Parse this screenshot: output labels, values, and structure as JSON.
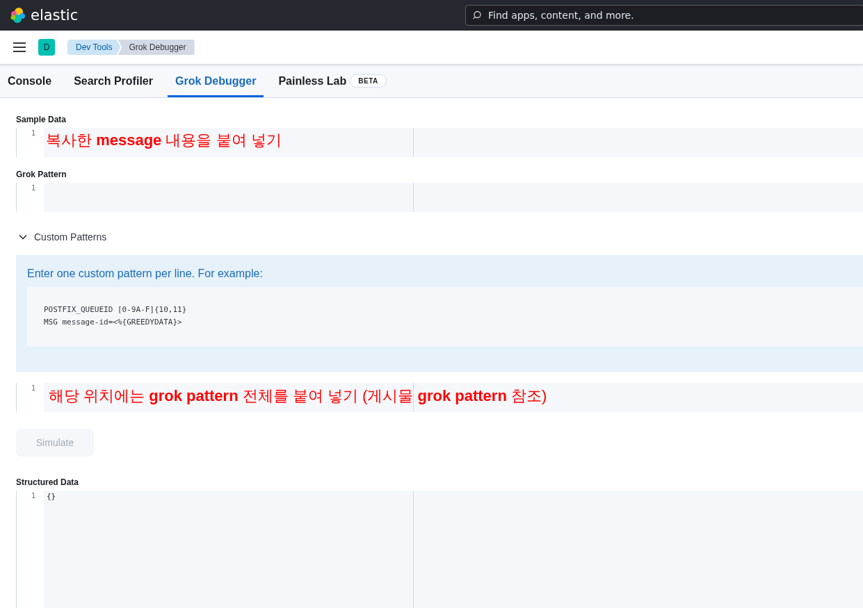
{
  "header": {
    "brand": "elastic",
    "search": {
      "placeholder": "Find apps, content, and more."
    }
  },
  "nav": {
    "space_initial": "D",
    "breadcrumbs": [
      {
        "label": "Dev Tools",
        "selected": false
      },
      {
        "label": "Grok Debugger",
        "selected": true
      }
    ]
  },
  "tabs": [
    {
      "label": "Console",
      "selected": false
    },
    {
      "label": "Search Profiler",
      "selected": false
    },
    {
      "label": "Grok Debugger",
      "selected": true
    },
    {
      "label": "Painless Lab",
      "selected": false,
      "badge": "BETA"
    }
  ],
  "sample_data": {
    "label": "Sample Data",
    "line_number": "1",
    "annotation": "복사한 **message** 내용을 붙여 넣기"
  },
  "grok_pattern": {
    "label": "Grok Pattern",
    "line_number": "1"
  },
  "custom_patterns": {
    "label": "Custom Patterns",
    "expanded": true,
    "help": "Enter one custom pattern per line. For example:",
    "example_lines": [
      "POSTFIX_QUEUEID [0-9A-F]{10,11}",
      "MSG message-id=<%{GREEDYDATA}>"
    ],
    "line_number": "1",
    "annotation": "해당 위치에는 **grok pattern** 전체를 붙여 넣기 (게시물 **grok pattern** 참조)"
  },
  "simulate_button": {
    "label": "Simulate",
    "disabled": true
  },
  "structured_data": {
    "label": "Structured Data",
    "line_number": "1",
    "value": "{}"
  }
}
